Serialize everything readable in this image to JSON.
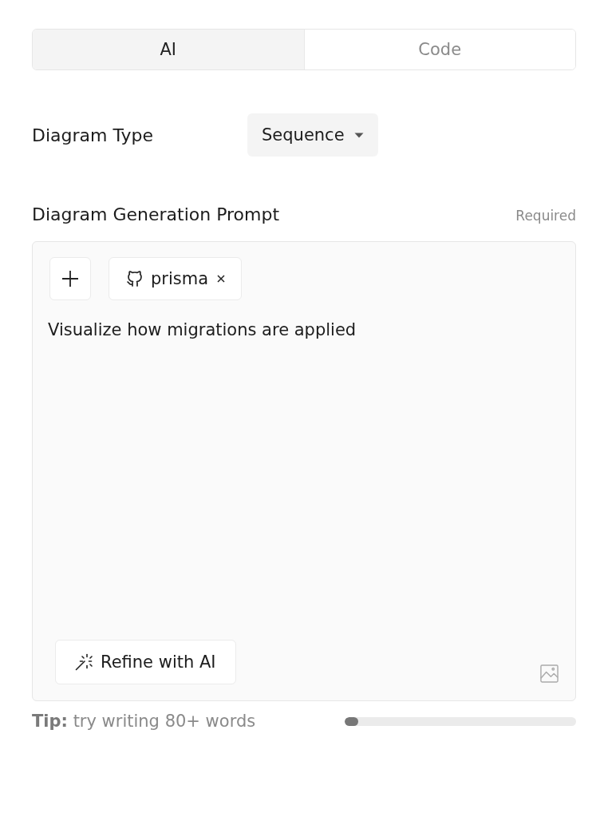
{
  "tabs": [
    {
      "label": "AI",
      "selected": true
    },
    {
      "label": "Code",
      "selected": false
    }
  ],
  "diagram_type": {
    "label": "Diagram Type",
    "value": "Sequence"
  },
  "prompt": {
    "label": "Diagram Generation Prompt",
    "hint": "Required",
    "attachments": [
      {
        "kind": "repo",
        "label": "prisma"
      }
    ],
    "value": "Visualize how migrations are applied",
    "refine_button": "Refine with AI"
  },
  "tip": {
    "text": "**Tip:** try writing 80+ words",
    "level": 0.06
  }
}
